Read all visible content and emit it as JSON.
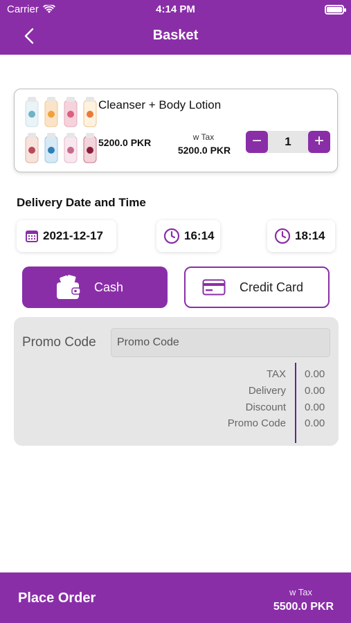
{
  "status_bar": {
    "carrier": "Carrier",
    "time": "4:14 PM"
  },
  "nav": {
    "title": "Basket"
  },
  "cart": {
    "item": {
      "name": "Cleanser + Body Lotion",
      "price": "5200.0 PKR",
      "tax_label": "w Tax",
      "tax_price": "5200.0 PKR",
      "quantity": "1",
      "minus": "−",
      "plus": "+"
    }
  },
  "delivery": {
    "title": "Delivery Date and Time",
    "date": "2021-12-17",
    "time_from": "16:14",
    "time_to": "18:14"
  },
  "payment": {
    "cash_label": "Cash",
    "card_label": "Credit Card",
    "selected": "Cash"
  },
  "summary": {
    "promo_label": "Promo Code",
    "promo_placeholder": "Promo Code",
    "rows": [
      {
        "label": "TAX",
        "value": "0.00"
      },
      {
        "label": "Delivery",
        "value": "0.00"
      },
      {
        "label": "Discount",
        "value": "0.00"
      },
      {
        "label": "Promo Code",
        "value": "0.00"
      }
    ]
  },
  "footer": {
    "place_order": "Place Order",
    "tax_label": "w Tax",
    "total": "5500.0 PKR"
  },
  "colors": {
    "brand": "#8a2ea8",
    "panel": "#e6e6e6"
  }
}
